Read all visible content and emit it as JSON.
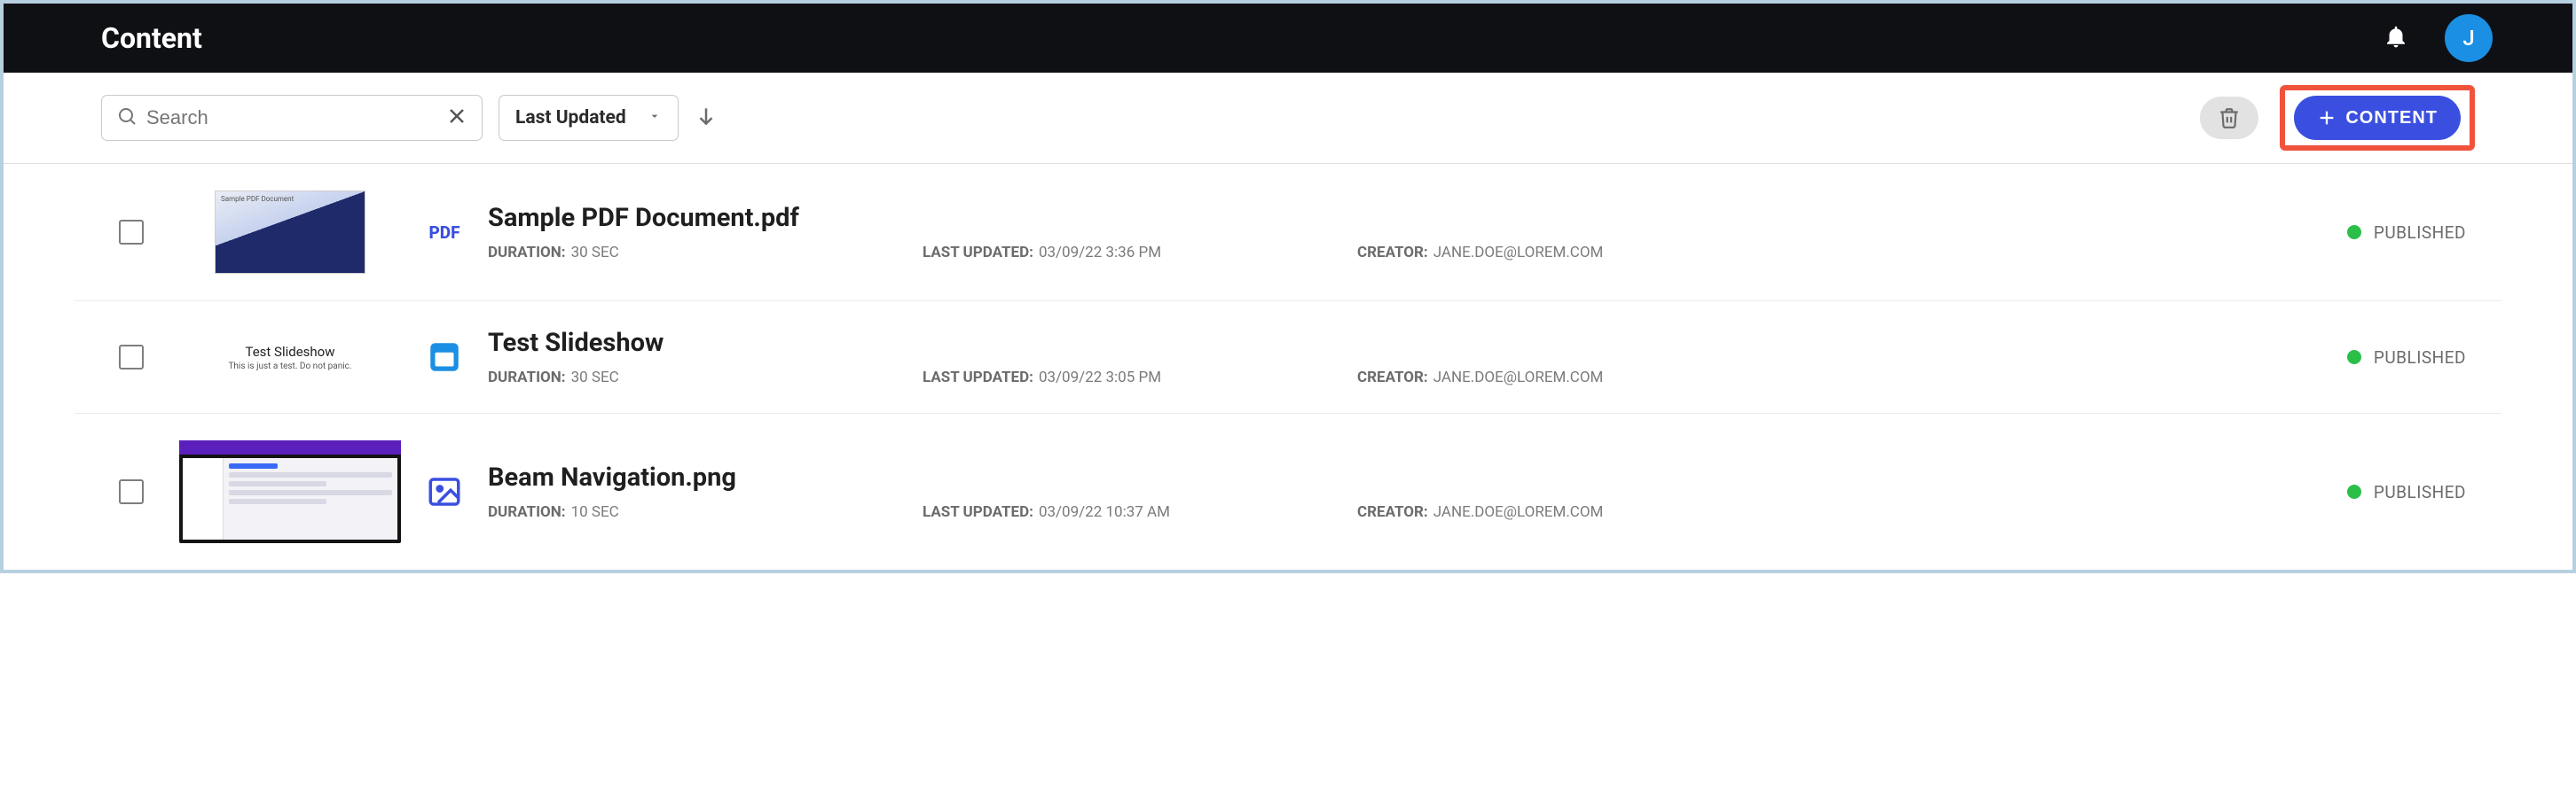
{
  "header": {
    "title": "Content",
    "avatar_letter": "J"
  },
  "toolbar": {
    "search_placeholder": "Search",
    "sort_label": "Last Updated",
    "add_button": "CONTENT"
  },
  "rows": [
    {
      "type": "PDF",
      "title": "Sample PDF Document.pdf",
      "duration": "30 SEC",
      "updated": "03/09/22 3:36 PM",
      "creator": "JANE.DOE@LOREM.COM",
      "status": "PUBLISHED"
    },
    {
      "type": "SLIDESHOW",
      "thumb_title": "Test Slideshow",
      "thumb_sub": "This is just a test. Do not panic.",
      "title": "Test Slideshow",
      "duration": "30 SEC",
      "updated": "03/09/22 3:05 PM",
      "creator": "JANE.DOE@LOREM.COM",
      "status": "PUBLISHED"
    },
    {
      "type": "IMAGE",
      "title": "Beam Navigation.png",
      "duration": "10 SEC",
      "updated": "03/09/22 10:37 AM",
      "creator": "JANE.DOE@LOREM.COM",
      "status": "PUBLISHED"
    }
  ],
  "labels": {
    "duration": "DURATION:",
    "updated": "LAST UPDATED:",
    "creator": "CREATOR:"
  }
}
